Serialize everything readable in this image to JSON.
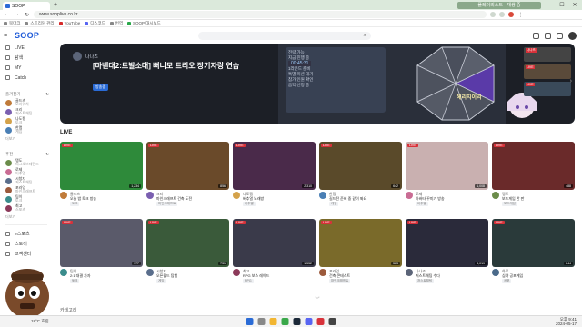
{
  "browser": {
    "tab_title": "SOOP",
    "url": "www.sooplive.co.kr",
    "media_label": "플레이리스트 · 재생 중"
  },
  "bookmarks": [
    "북마크",
    "스트리밍 관리",
    "YouTube",
    "디스코드",
    "번역",
    "SOOP 대시보드"
  ],
  "header": {
    "logo": "SOOP",
    "search_icon": "search-icon"
  },
  "sidebar": {
    "nav": [
      {
        "label": "LIVE",
        "icon": "broadcast-icon"
      },
      {
        "label": "탐색",
        "icon": "compass-icon"
      },
      {
        "label": "MY",
        "icon": "heart-icon"
      },
      {
        "label": "Catch",
        "icon": "catch-icon"
      }
    ],
    "section1": "즐겨찾기",
    "fav_channels": [
      {
        "name": "골드츠",
        "sub": "오버워치",
        "color": "#c07b3a"
      },
      {
        "name": "크리",
        "sub": "저스트채팅",
        "color": "#7a5fb0"
      },
      {
        "name": "나도팽",
        "sub": "토크",
        "color": "#d4a24a"
      },
      {
        "name": "한랭",
        "sub": "게임",
        "color": "#4a7fb5"
      }
    ],
    "more1": "더보기",
    "section2": "추천",
    "rec_channels": [
      {
        "name": "탱도",
        "sub": "리그오브레전드",
        "color": "#6b8c4a"
      },
      {
        "name": "로제",
        "sub": "버추얼",
        "color": "#c96c94"
      },
      {
        "name": "시청자",
        "sub": "저스트채팅",
        "color": "#5a6e8c"
      },
      {
        "name": "포라잉",
        "sub": "마인크래프트",
        "color": "#9c5a3c"
      },
      {
        "name": "팀이",
        "sub": "토크",
        "color": "#3a8c8c"
      },
      {
        "name": "최고",
        "sub": "스포츠",
        "color": "#8c3a5a"
      }
    ],
    "more2": "더보기",
    "extra": [
      {
        "label": "e스포츠",
        "icon": "trophy-icon"
      },
      {
        "label": "스토어",
        "icon": "shop-icon"
      },
      {
        "label": "고객센터",
        "icon": "help-icon"
      }
    ]
  },
  "banner": {
    "streamer": "나나즈",
    "title": "[마벤대2:트발소대] 뻐니모 트리오 장기자랑 연습",
    "badge": "방송중",
    "panel_title": "전략 가능",
    "panel_sub": "지금 진행 중",
    "timer": "00:45:31",
    "panel_lines": [
      "1라운드 준비",
      "특별 미션 대기",
      "참가 인원 확인",
      "음악 선정 중"
    ],
    "chibi_text": "헤리지이리",
    "thumb_labels": [
      "나나즈",
      "LIVE",
      "LIVE"
    ]
  },
  "live_header": "LIVE",
  "cards": [
    {
      "name": "골드츠",
      "title": "오늘 밤 토크 방송",
      "tag": "토크",
      "viewers": "1,234",
      "bg": "#2e8a3a",
      "av": "#c07b3a"
    },
    {
      "name": "크리",
      "title": "마인크래프트 건축 도전",
      "tag": "마인크래프트",
      "viewers": "856",
      "bg": "#6a4a2a",
      "av": "#7a5fb0"
    },
    {
      "name": "나도팽",
      "title": "버추얼 노래방",
      "tag": "버추얼",
      "viewers": "2,310",
      "bg": "#4a2a4a",
      "av": "#d4a24a"
    },
    {
      "name": "한랭",
      "title": "길드전 준비 중 같이 봐요",
      "tag": "게임",
      "viewers": "642",
      "bg": "#5a4a2a",
      "av": "#4a7fb5"
    },
    {
      "name": "로제",
      "title": "아바타 꾸미기 방송",
      "tag": "버추얼",
      "viewers": "1,008",
      "bg": "#c9b0b0",
      "av": "#c96c94"
    },
    {
      "name": "탱도",
      "title": "보드게임 한 판",
      "tag": "보드게임",
      "viewers": "488",
      "bg": "#6a2a2a",
      "av": "#6b8c4a"
    },
    {
      "name": "팀이",
      "title": "2:1 대결 가자",
      "tag": "토크",
      "viewers": "977",
      "bg": "#5a5a6a",
      "av": "#3a8c8c"
    },
    {
      "name": "시청자",
      "title": "오픈월드 탐험",
      "tag": "게임",
      "viewers": "731",
      "bg": "#3a5a3a",
      "av": "#5a6e8c"
    },
    {
      "name": "최고",
      "title": "RPG 보스 레이드",
      "tag": "RPG",
      "viewers": "1,552",
      "bg": "#3a3a4a",
      "av": "#8c3a5a"
    },
    {
      "name": "포라잉",
      "title": "건축 콘테스트",
      "tag": "마인크래프트",
      "viewers": "523",
      "bg": "#7a6a2a",
      "av": "#9c5a3c"
    },
    {
      "name": "나나즈",
      "title": "저스트채팅 수다",
      "tag": "저스트채팅",
      "viewers": "3,019",
      "bg": "#2a2a3a",
      "av": "#5b6478"
    },
    {
      "name": "하루",
      "title": "심야 공포게임",
      "tag": "공포",
      "viewers": "844",
      "bg": "#2a3a3a",
      "av": "#4a6a8a"
    }
  ],
  "more_label": "︾",
  "bottom_section": "카테고리",
  "taskbar": {
    "weather": "18°C 흐림",
    "time": "오후 9:41",
    "date": "2024-05-17"
  }
}
